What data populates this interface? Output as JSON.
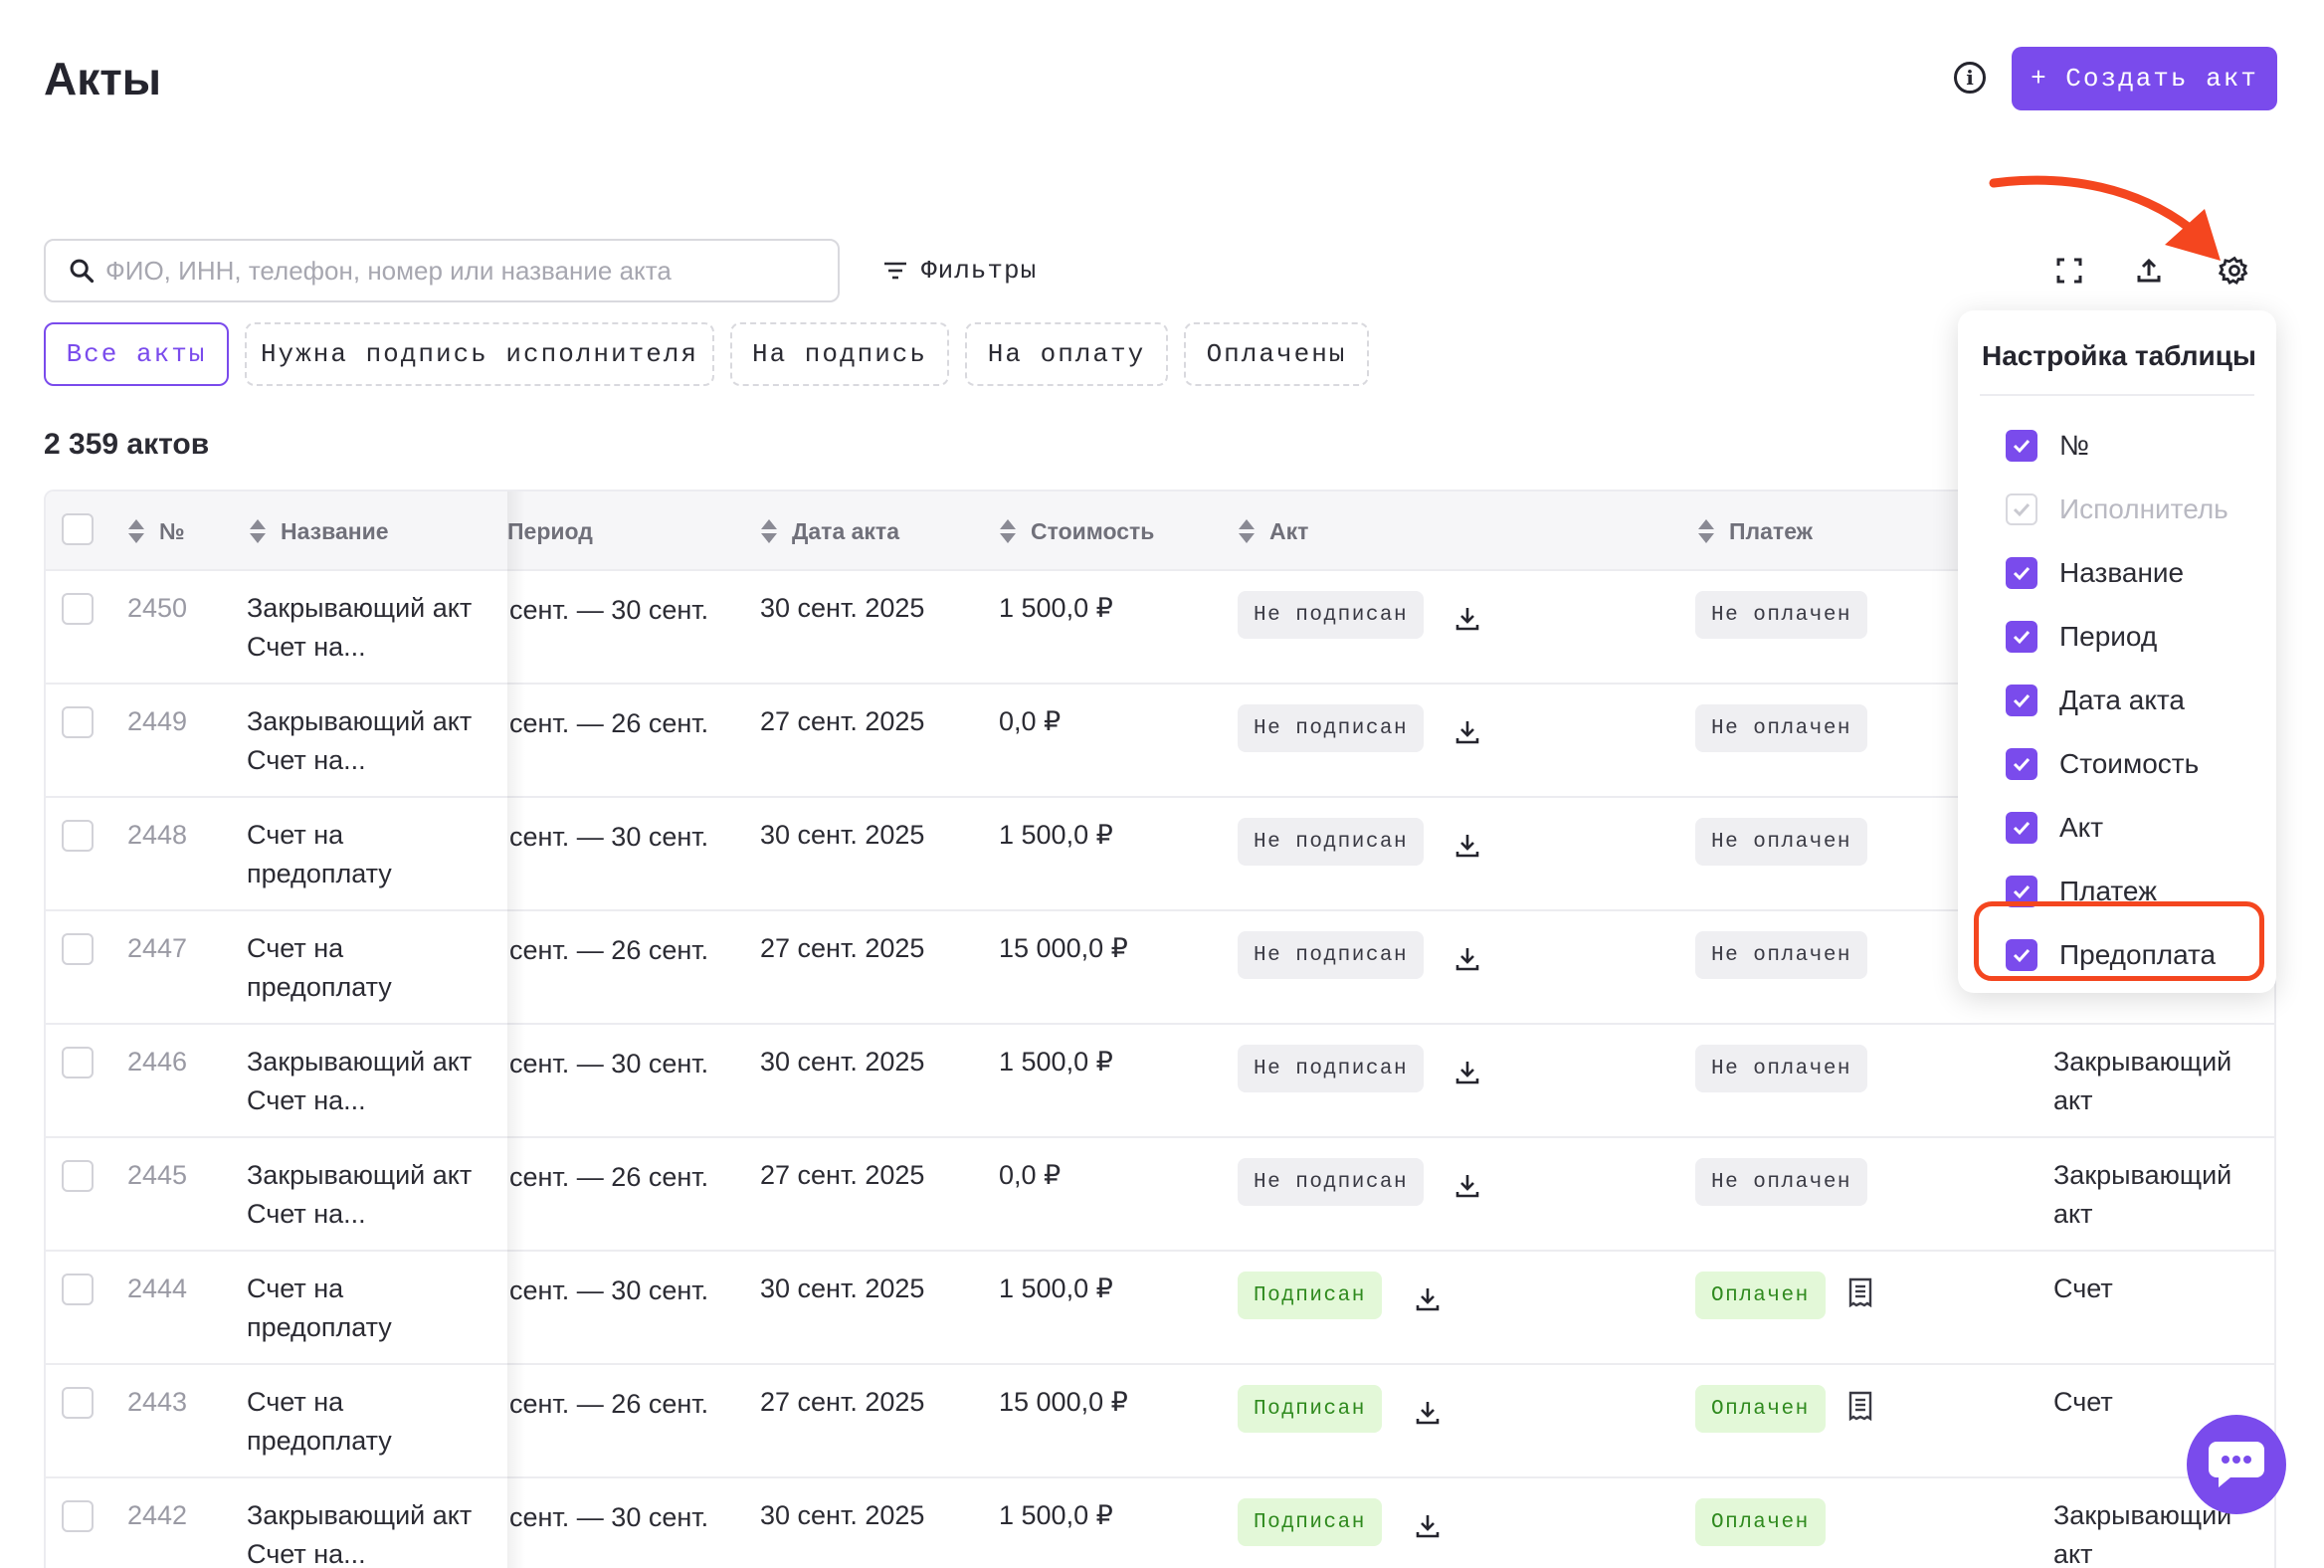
{
  "header": {
    "title": "Акты",
    "create_label": "+ Создать акт"
  },
  "toolbar": {
    "search_placeholder": "ФИО, ИНН, телефон, номер или название акта",
    "filters_label": "Фильтры"
  },
  "tabs": [
    {
      "label": "Все акты",
      "active": true
    },
    {
      "label": "Нужна подпись исполнителя"
    },
    {
      "label": "На подпись"
    },
    {
      "label": "На оплату"
    },
    {
      "label": "Оплачены"
    }
  ],
  "count_label": "2 359 актов",
  "table": {
    "headers": {
      "num": "№",
      "name": "Название",
      "period": "Период",
      "date": "Дата акта",
      "cost": "Стоимость",
      "act": "Акт",
      "payment": "Платеж"
    },
    "rows": [
      {
        "num": "2450",
        "name1": "Закрывающий акт",
        "name2": "Счет на...",
        "period": "сент. — 30 сент.",
        "date": "30 сент. 2025",
        "cost": "1 500,0 ₽",
        "act": "Не подписан",
        "payment": "Не оплачен",
        "prepay1": "",
        "prepay2": ""
      },
      {
        "num": "2449",
        "name1": "Закрывающий акт",
        "name2": "Счет на...",
        "period": "сент. — 26 сент.",
        "date": "27 сент. 2025",
        "cost": "0,0 ₽",
        "act": "Не подписан",
        "payment": "Не оплачен",
        "prepay1": "",
        "prepay2": ""
      },
      {
        "num": "2448",
        "name1": "Счет на",
        "name2": "предоплату",
        "period": "сент. — 30 сент.",
        "date": "30 сент. 2025",
        "cost": "1 500,0 ₽",
        "act": "Не подписан",
        "payment": "Не оплачен",
        "prepay1": "",
        "prepay2": ""
      },
      {
        "num": "2447",
        "name1": "Счет на",
        "name2": "предоплату",
        "period": "сент. — 26 сент.",
        "date": "27 сент. 2025",
        "cost": "15 000,0 ₽",
        "act": "Не подписан",
        "payment": "Не оплачен",
        "prepay1": "",
        "prepay2": ""
      },
      {
        "num": "2446",
        "name1": "Закрывающий акт",
        "name2": "Счет на...",
        "period": "сент. — 30 сент.",
        "date": "30 сент. 2025",
        "cost": "1 500,0 ₽",
        "act": "Не подписан",
        "payment": "Не оплачен",
        "prepay1": "Закрывающий",
        "prepay2": "акт"
      },
      {
        "num": "2445",
        "name1": "Закрывающий акт",
        "name2": "Счет на...",
        "period": "сент. — 26 сент.",
        "date": "27 сент. 2025",
        "cost": "0,0 ₽",
        "act": "Не подписан",
        "payment": "Не оплачен",
        "prepay1": "Закрывающий",
        "prepay2": "акт"
      },
      {
        "num": "2444",
        "name1": "Счет на",
        "name2": "предоплату",
        "period": "сент. — 30 сент.",
        "date": "30 сент. 2025",
        "cost": "1 500,0 ₽",
        "act": "Подписан",
        "payment": "Оплачен",
        "prepay1": "Счет",
        "prepay2": ""
      },
      {
        "num": "2443",
        "name1": "Счет на",
        "name2": "предоплату",
        "period": "сент. — 26 сент.",
        "date": "27 сент. 2025",
        "cost": "15 000,0 ₽",
        "act": "Подписан",
        "payment": "Оплачен",
        "prepay1": "Счет",
        "prepay2": ""
      },
      {
        "num": "2442",
        "name1": "Закрывающий акт",
        "name2": "Счет на...",
        "period": "сент. — 30 сент.",
        "date": "30 сент. 2025",
        "cost": "1 500,0 ₽",
        "act": "Подписан",
        "payment": "Оплачен",
        "prepay1": "Закрывающий",
        "prepay2": "акт"
      }
    ]
  },
  "settings_popover": {
    "title": "Настройка таблицы",
    "items": [
      {
        "label": "№",
        "checked": true
      },
      {
        "label": "Исполнитель",
        "checked": true,
        "disabled": true
      },
      {
        "label": "Название",
        "checked": true
      },
      {
        "label": "Период",
        "checked": true
      },
      {
        "label": "Дата акта",
        "checked": true
      },
      {
        "label": "Стоимость",
        "checked": true
      },
      {
        "label": "Акт",
        "checked": true
      },
      {
        "label": "Платеж",
        "checked": true
      },
      {
        "label": "Предоплата",
        "checked": true
      }
    ]
  },
  "colors": {
    "accent": "#7a4bec",
    "annotation": "#f4461f",
    "paid_bg": "#e3f8d8",
    "paid_text": "#2f8a1e",
    "unpaid_bg": "#efeff2"
  },
  "icons": [
    "info-icon",
    "search-icon",
    "filter-icon",
    "fullscreen-icon",
    "export-icon",
    "gear-icon",
    "sort-icon",
    "download-icon",
    "receipt-icon",
    "chat-icon",
    "check-icon"
  ]
}
